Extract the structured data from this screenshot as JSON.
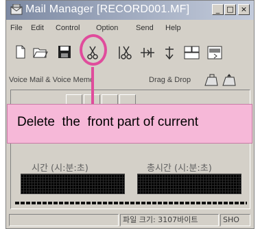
{
  "window": {
    "title": "Mail Manager [RECORD001.MF]",
    "controls": {
      "minimize": "_",
      "maximize": "□",
      "close": "×"
    }
  },
  "menu": {
    "items": [
      "File",
      "Edit",
      "Control",
      "Option",
      "Send",
      "Help"
    ]
  },
  "toolbar": {
    "buttons": [
      {
        "name": "new-file-icon"
      },
      {
        "name": "open-folder-icon"
      },
      {
        "name": "save-disk-icon"
      },
      {
        "name": "cut-front-icon"
      },
      {
        "name": "cut-back-icon"
      },
      {
        "name": "split-icon"
      },
      {
        "name": "insert-icon"
      },
      {
        "name": "window-icon"
      },
      {
        "name": "window-send-icon"
      }
    ]
  },
  "voicebar": {
    "left_label": "Voice Mail & Voice Memo",
    "right_label": "Drag & Drop"
  },
  "times": {
    "current_label": "시간 (시:분:초)",
    "total_label": "총시간 (시:분:초)"
  },
  "status": {
    "file_size": "파일 크기: 3107바이트",
    "mode": "SHO"
  },
  "tooltip": {
    "text": "Delete  the  front part of current"
  },
  "colors": {
    "accent_pink": "#e04c9c",
    "tooltip_bg": "#f6b8d8"
  }
}
